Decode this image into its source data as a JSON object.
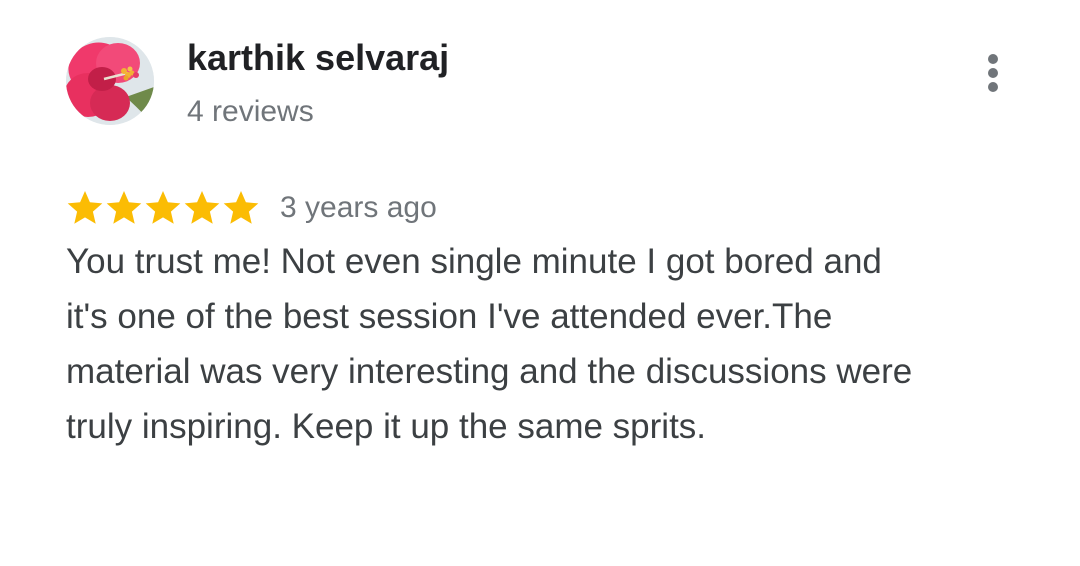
{
  "review": {
    "author": {
      "name": "karthik selvaraj",
      "review_count": "4 reviews",
      "avatar_icon": "hibiscus-flower-avatar"
    },
    "menu": {
      "icon": "more-vert-icon"
    },
    "rating": {
      "stars": 5,
      "max_stars": 5,
      "star_color": "#fbbc04",
      "icon": "star-icon"
    },
    "time_ago": "3 years ago",
    "text": "You trust me! Not even single minute I got bored and it's one of the best session I've attended ever.The material was very interesting and the discussions were truly inspiring. Keep it up the same sprits."
  }
}
